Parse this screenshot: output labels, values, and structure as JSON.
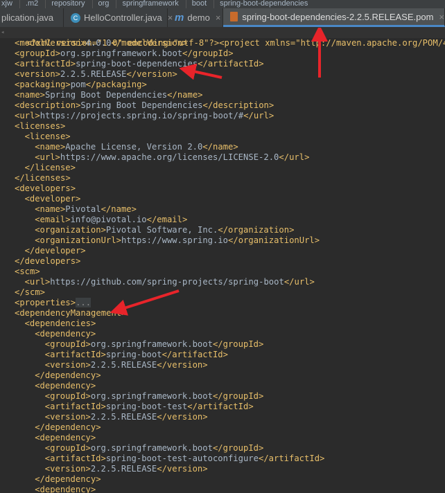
{
  "breadcrumbs": [
    "xjw",
    ".m2",
    "repository",
    "org",
    "springframework",
    "boot",
    "spring-boot-dependencies"
  ],
  "tabs": [
    {
      "label": "plication.java",
      "icon": "java-class-icon"
    },
    {
      "label": "HelloController.java",
      "icon": "java-class-icon"
    },
    {
      "label": "demo",
      "icon": "maven-module-icon"
    },
    {
      "label": "spring-boot-dependencies-2.2.5.RELEASE.pom",
      "icon": "pom-file-icon"
    }
  ],
  "editor": {
    "xml_decl": "<?xml version=\"1.0\" encoding=\"utf-8\"?>",
    "project_open": "<project xmlns=\"http://maven.apache.org/POM/4.0.0\"",
    "lines": [
      {
        "indent": 1,
        "tag": "modelVersion",
        "text": "4.0.0"
      },
      {
        "indent": 1,
        "tag": "groupId",
        "text": "org.springframework.boot"
      },
      {
        "indent": 1,
        "tag": "artifactId",
        "text": "spring-boot-dependencies"
      },
      {
        "indent": 1,
        "tag": "version",
        "text": "2.2.5.RELEASE"
      },
      {
        "indent": 1,
        "tag": "packaging",
        "text": "pom"
      },
      {
        "indent": 1,
        "tag": "name",
        "text": "Spring Boot Dependencies"
      },
      {
        "indent": 1,
        "tag": "description",
        "text": "Spring Boot Dependencies"
      },
      {
        "indent": 1,
        "tag": "url",
        "text": "https://projects.spring.io/spring-boot/#"
      },
      {
        "indent": 1,
        "open": "licenses"
      },
      {
        "indent": 2,
        "open": "license"
      },
      {
        "indent": 3,
        "tag": "name",
        "text": "Apache License, Version 2.0"
      },
      {
        "indent": 3,
        "tag": "url",
        "text": "https://www.apache.org/licenses/LICENSE-2.0"
      },
      {
        "indent": 2,
        "close": "license"
      },
      {
        "indent": 1,
        "close": "licenses"
      },
      {
        "indent": 1,
        "open": "developers"
      },
      {
        "indent": 2,
        "open": "developer"
      },
      {
        "indent": 3,
        "tag": "name",
        "text": "Pivotal"
      },
      {
        "indent": 3,
        "tag": "email",
        "text": "info@pivotal.io"
      },
      {
        "indent": 3,
        "tag": "organization",
        "text": "Pivotal Software, Inc."
      },
      {
        "indent": 3,
        "tag": "organizationUrl",
        "text": "https://www.spring.io"
      },
      {
        "indent": 2,
        "close": "developer"
      },
      {
        "indent": 1,
        "close": "developers"
      },
      {
        "indent": 1,
        "open": "scm"
      },
      {
        "indent": 2,
        "tag": "url",
        "text": "https://github.com/spring-projects/spring-boot"
      },
      {
        "indent": 1,
        "close": "scm"
      },
      {
        "indent": 1,
        "folded": "properties",
        "fold_text": "..."
      },
      {
        "indent": 1,
        "open": "dependencyManagement"
      },
      {
        "indent": 2,
        "open": "dependencies"
      },
      {
        "indent": 3,
        "open": "dependency"
      },
      {
        "indent": 4,
        "tag": "groupId",
        "text": "org.springframework.boot"
      },
      {
        "indent": 4,
        "tag": "artifactId",
        "text": "spring-boot"
      },
      {
        "indent": 4,
        "tag": "version",
        "text": "2.2.5.RELEASE"
      },
      {
        "indent": 3,
        "close": "dependency"
      },
      {
        "indent": 3,
        "open": "dependency"
      },
      {
        "indent": 4,
        "tag": "groupId",
        "text": "org.springframework.boot"
      },
      {
        "indent": 4,
        "tag": "artifactId",
        "text": "spring-boot-test"
      },
      {
        "indent": 4,
        "tag": "version",
        "text": "2.2.5.RELEASE"
      },
      {
        "indent": 3,
        "close": "dependency"
      },
      {
        "indent": 3,
        "open": "dependency"
      },
      {
        "indent": 4,
        "tag": "groupId",
        "text": "org.springframework.boot"
      },
      {
        "indent": 4,
        "tag": "artifactId",
        "text": "spring-boot-test-autoconfigure"
      },
      {
        "indent": 4,
        "tag": "version",
        "text": "2.2.5.RELEASE"
      },
      {
        "indent": 3,
        "close": "dependency"
      },
      {
        "indent": 3,
        "open": "dependency"
      }
    ]
  },
  "colors": {
    "tag": "#e8bf6a",
    "text": "#a9b7c6",
    "string": "#6a8759",
    "background": "#2b2b2b",
    "annotation_arrow": "#e8242a",
    "active_tab_underline": "#4a88c7"
  }
}
